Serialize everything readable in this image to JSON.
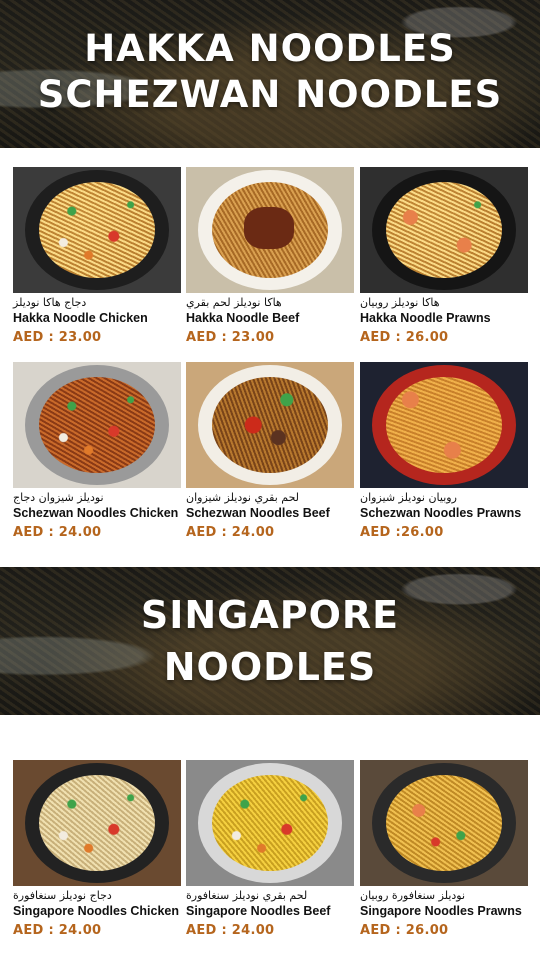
{
  "colors": {
    "price": "#b5651d",
    "title": "#ffffff"
  },
  "section1": {
    "title_line1": "HAKKA NOODLES",
    "title_line2": "SCHEZWAN NOODLES"
  },
  "section2": {
    "title_line1": "SINGAPORE",
    "title_line2": "NOODLES"
  },
  "items": [
    {
      "arabic": "دجاج هاكا نوديلز",
      "name": "Hakka Noodle Chicken",
      "price": "AED : 23.00",
      "image": "hakka-chicken-photo"
    },
    {
      "arabic": "هاكا نوديلز لحم بقري",
      "name": "Hakka Noodle Beef",
      "price": "AED : 23.00",
      "image": "hakka-beef-photo"
    },
    {
      "arabic": "هاكا نوديلز روبيان",
      "name": "Hakka Noodle Prawns",
      "price": "AED : 26.00",
      "image": "hakka-prawns-photo"
    },
    {
      "arabic": "نوديلز شيزوان دجاج",
      "name": "Schezwan Noodles Chicken",
      "price": "AED : 24.00",
      "image": "schezwan-chicken-photo"
    },
    {
      "arabic": "لحم بقري نوديلز شيزوان",
      "name": "Schezwan Noodles Beef",
      "price": "AED : 24.00",
      "image": "schezwan-beef-photo"
    },
    {
      "arabic": "روبيان نوديلز شيزوان",
      "name": "Schezwan Noodles Prawns",
      "price": "AED :26.00",
      "image": "schezwan-prawns-photo"
    },
    {
      "arabic": "دجاج نوديلز سنغافورة",
      "name": "Singapore Noodles Chicken",
      "price": "AED : 24.00",
      "image": "singapore-chicken-photo"
    },
    {
      "arabic": "لحم بقري نوديلز سنغافورة",
      "name": "Singapore Noodles Beef",
      "price": "AED : 24.00",
      "image": "singapore-beef-photo"
    },
    {
      "arabic": "نوديلز سنغافورة روبيان",
      "name": "Singapore Noodles Prawns",
      "price": "AED : 26.00",
      "image": "singapore-prawns-photo"
    }
  ]
}
